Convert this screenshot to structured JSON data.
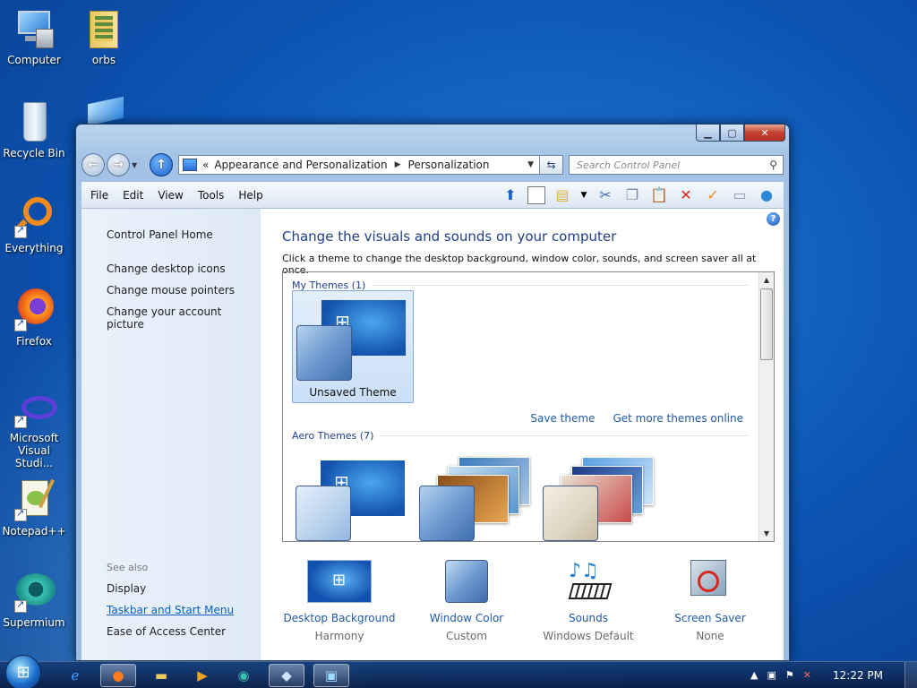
{
  "desktop": {
    "icons": [
      {
        "label": "Computer",
        "icon": "computer-icon"
      },
      {
        "label": "orbs",
        "icon": "folder-icon"
      },
      {
        "label": "Recycle Bin",
        "icon": "recycle-bin-icon"
      },
      {
        "label": "Everything",
        "icon": "everything-icon"
      },
      {
        "label": "Firefox",
        "icon": "firefox-icon"
      },
      {
        "label": "Microsoft Visual Studi...",
        "icon": "visual-studio-icon"
      },
      {
        "label": "Notepad++",
        "icon": "notepad-plus-plus-icon"
      },
      {
        "label": "Supermium",
        "icon": "supermium-icon"
      }
    ]
  },
  "window": {
    "address": {
      "prefix": "«",
      "crumb1": "Appearance and Personalization",
      "crumb2": "Personalization"
    },
    "search_placeholder": "Search Control Panel",
    "menu": [
      "File",
      "Edit",
      "View",
      "Tools",
      "Help"
    ],
    "left_pane": {
      "home": "Control Panel Home",
      "links": [
        "Change desktop icons",
        "Change mouse pointers",
        "Change your account picture"
      ],
      "see_also_header": "See also",
      "see_also": [
        "Display",
        "Taskbar and Start Menu",
        "Ease of Access Center"
      ]
    },
    "main": {
      "title": "Change the visuals and sounds on your computer",
      "description": "Click a theme to change the desktop background, window color, sounds, and screen saver all at once.",
      "my_themes_header": "My Themes (1)",
      "unsaved_theme": "Unsaved Theme",
      "save_theme": "Save theme",
      "get_more": "Get more themes online",
      "aero_header": "Aero Themes (7)"
    },
    "bottom": {
      "background": {
        "label": "Desktop Background",
        "sub": "Harmony"
      },
      "color": {
        "label": "Window Color",
        "sub": "Custom"
      },
      "sounds": {
        "label": "Sounds",
        "sub": "Windows Default"
      },
      "saver": {
        "label": "Screen Saver",
        "sub": "None"
      }
    }
  },
  "taskbar": {
    "clock": "12:22 PM"
  }
}
